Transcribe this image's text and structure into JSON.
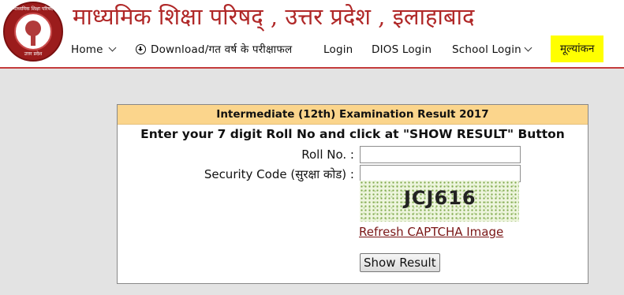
{
  "header": {
    "title": "माध्यमिक शिक्षा परिषद् , उत्तर प्रदेश , इलाहाबाद",
    "logo_top_text": "माध्यमिक शिक्षा परिषद",
    "logo_bottom_text": "उत्तर प्रदेश",
    "accent_color": "#b02828"
  },
  "nav": {
    "home": "Home",
    "download": "Download/गत वर्ष के परीक्षाफल",
    "login": "Login",
    "dios_login": "DIOS Login",
    "school_login": "School Login",
    "evaluation": "मूल्यांकन",
    "highlight_color": "#ffff00"
  },
  "result_form": {
    "heading": "Intermediate (12th) Examination Result 2017",
    "instruction": "Enter your 7 digit Roll No and click at \"SHOW RESULT\" Button",
    "roll_label": "Roll No. :",
    "roll_value": "",
    "security_label": "Security Code (सुरक्षा कोड) :",
    "security_value": "",
    "captcha_text": "JCJ616",
    "refresh_link": "Refresh CAPTCHA Image",
    "submit_label": "Show Result",
    "heading_bg": "#fbd58c"
  }
}
